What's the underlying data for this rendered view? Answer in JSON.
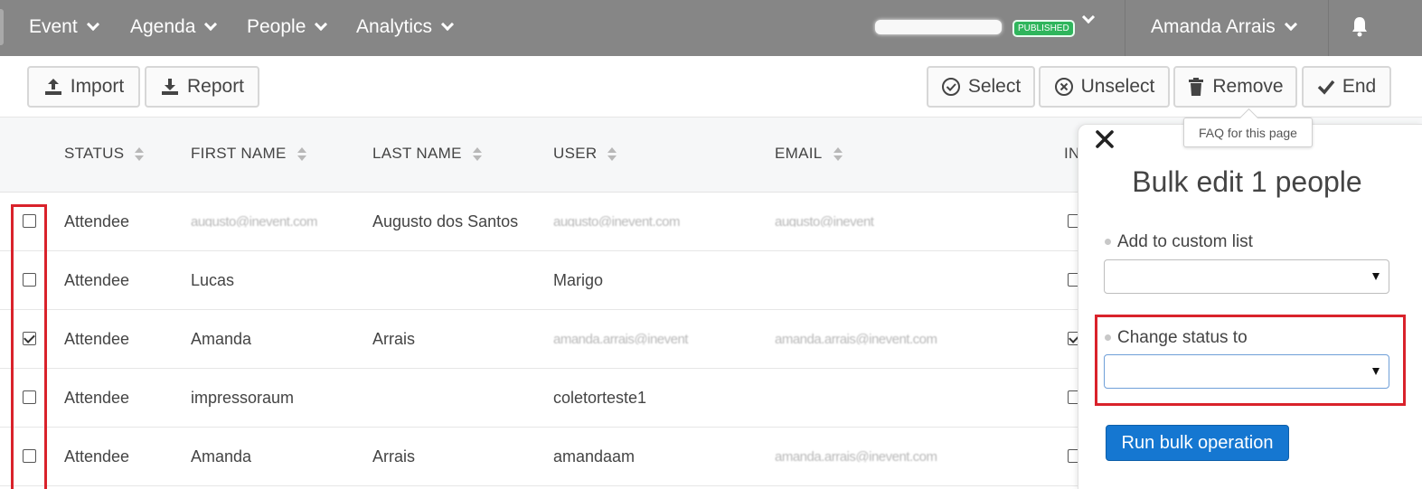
{
  "nav": {
    "items": [
      {
        "label": "Event"
      },
      {
        "label": "Agenda"
      },
      {
        "label": "People"
      },
      {
        "label": "Analytics"
      }
    ],
    "status_badge": "PUBLISHED",
    "user_name": "Amanda Arrais",
    "icons": {
      "notification": "bell-icon",
      "dropdown": "chevron-down-icon"
    }
  },
  "toolbar": {
    "import_label": "Import",
    "report_label": "Report",
    "select_label": "Select",
    "unselect_label": "Unselect",
    "remove_label": "Remove",
    "end_label": "End"
  },
  "tooltip": "FAQ for this page",
  "table": {
    "columns": [
      "STATUS",
      "FIRST NAME",
      "LAST NAME",
      "USER",
      "EMAIL",
      "IN"
    ],
    "rows": [
      {
        "checked": false,
        "status": "Attendee",
        "first_name": "augusto@inevent.com",
        "last_name": "Augusto dos Santos",
        "user": "augusto@inevent.com",
        "email": "augusto@inevent",
        "in_checked": false
      },
      {
        "checked": false,
        "status": "Attendee",
        "first_name": "Lucas",
        "last_name": "",
        "user": "Marigo",
        "email": "",
        "in_checked": false
      },
      {
        "checked": true,
        "status": "Attendee",
        "first_name": "Amanda",
        "last_name": "Arrais",
        "user": "amanda.arrais@inevent",
        "email": "amanda.arrais@inevent.com",
        "in_checked": true
      },
      {
        "checked": false,
        "status": "Attendee",
        "first_name": "impressoraum",
        "last_name": "",
        "user": "coletorteste1",
        "email": "",
        "in_checked": false
      },
      {
        "checked": false,
        "status": "Attendee",
        "first_name": "Amanda",
        "last_name": "Arrais",
        "user": "amandaam",
        "email": "amanda.arrais@inevent.com",
        "in_checked": false
      }
    ]
  },
  "panel": {
    "title": "Bulk edit 1 people",
    "custom_list_label": "Add to custom list",
    "custom_list_value": "",
    "status_label": "Change status to",
    "status_value": "",
    "run_label": "Run bulk operation"
  },
  "colors": {
    "nav_bg": "#868686",
    "highlight": "#d9222b",
    "primary": "#1577d1",
    "published": "#2fb55c"
  }
}
